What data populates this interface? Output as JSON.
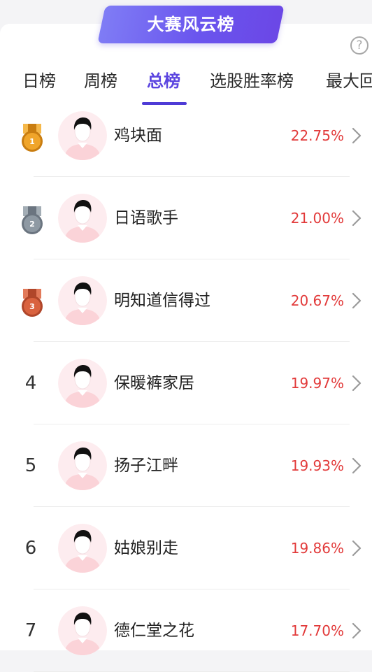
{
  "banner": {
    "title": "大赛风云榜"
  },
  "help_icon": {
    "glyph": "?"
  },
  "tabs": [
    {
      "label": "日榜",
      "active": false
    },
    {
      "label": "周榜",
      "active": false
    },
    {
      "label": "总榜",
      "active": true
    },
    {
      "label": "选股胜率榜",
      "active": false
    },
    {
      "label": "最大回",
      "active": false
    }
  ],
  "colors": {
    "accent": "#5b45e0",
    "positive": "#e23a3a",
    "banner_start": "#7f7cf5",
    "banner_end": "#6b47e6",
    "gold": "#f0a52a",
    "silver": "#8e99a3",
    "bronze": "#d9623f"
  },
  "rankings": [
    {
      "rank": "1",
      "medal": "gold",
      "name": "鸡块面",
      "return": "22.75%"
    },
    {
      "rank": "2",
      "medal": "silver",
      "name": "日语歌手",
      "return": "21.00%"
    },
    {
      "rank": "3",
      "medal": "bronze",
      "name": "明知道信得过",
      "return": "20.67%"
    },
    {
      "rank": "4",
      "medal": null,
      "name": "保暖裤家居",
      "return": "19.97%"
    },
    {
      "rank": "5",
      "medal": null,
      "name": "扬子江畔",
      "return": "19.93%"
    },
    {
      "rank": "6",
      "medal": null,
      "name": "姑娘别走",
      "return": "19.86%"
    },
    {
      "rank": "7",
      "medal": null,
      "name": "德仁堂之花",
      "return": "17.70%"
    }
  ]
}
